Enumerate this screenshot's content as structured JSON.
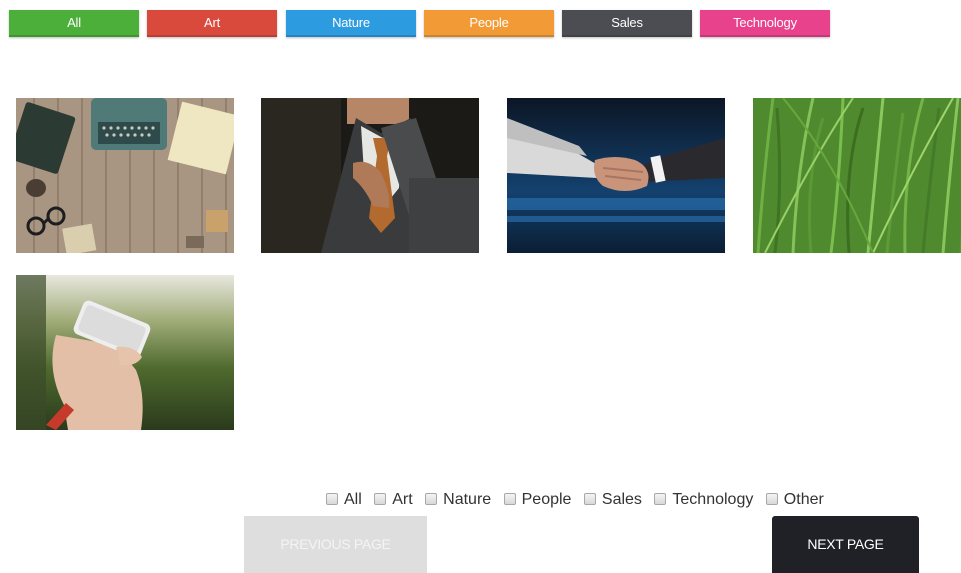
{
  "filters": [
    {
      "label": "All",
      "color": "#4caf3a"
    },
    {
      "label": "Art",
      "color": "#d94a3c"
    },
    {
      "label": "Nature",
      "color": "#2d9be0"
    },
    {
      "label": "People",
      "color": "#f19a36"
    },
    {
      "label": "Sales",
      "color": "#4b4d52"
    },
    {
      "label": "Technology",
      "color": "#e8428c"
    }
  ],
  "gallery": [
    {
      "name": "desk-typewriter-photo",
      "subject": "typewriter on wooden desk"
    },
    {
      "name": "businessman-tie-photo",
      "subject": "man in suit adjusting tie"
    },
    {
      "name": "handshake-photo",
      "subject": "business handshake"
    },
    {
      "name": "grass-photo",
      "subject": "green grass close-up"
    },
    {
      "name": "smartphone-hand-photo",
      "subject": "hand holding smartphone outdoors"
    }
  ],
  "checkboxes": [
    {
      "label": "All"
    },
    {
      "label": "Art"
    },
    {
      "label": "Nature"
    },
    {
      "label": "People"
    },
    {
      "label": "Sales"
    },
    {
      "label": "Technology"
    },
    {
      "label": "Other"
    }
  ],
  "pagination": {
    "previous_label": "PREVIOUS PAGE",
    "next_label": "NEXT PAGE"
  }
}
